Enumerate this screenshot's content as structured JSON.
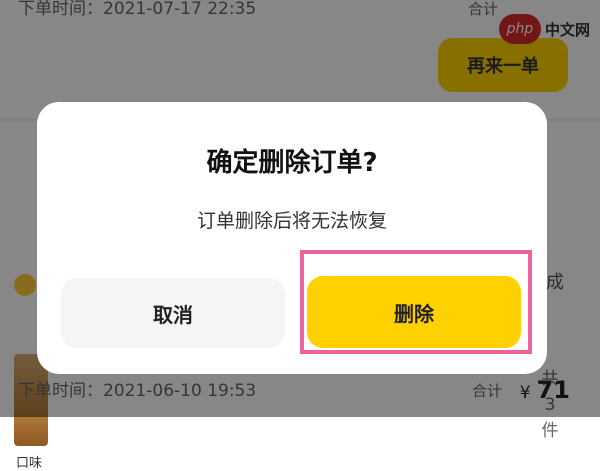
{
  "background": {
    "top_order": {
      "time": "下单时间：2021-07-17 22:35",
      "total_label": "合计",
      "reorder_label": "再来一单"
    },
    "bottom_order": {
      "status": "已完成",
      "thumb_label": "口味",
      "item_count": "共3件",
      "time": "下单时间：2021-06-10 19:53",
      "total_label": "合计",
      "currency": "¥",
      "amount": "71"
    },
    "watermark": {
      "logo": "php",
      "text": "中文网"
    }
  },
  "dialog": {
    "title": "确定删除订单?",
    "message": "订单删除后将无法恢复",
    "cancel_label": "取消",
    "delete_label": "删除"
  },
  "colors": {
    "accent": "#ffd100",
    "highlight": "#e8649a",
    "overlay": "rgba(0,0,0,0.47)"
  }
}
